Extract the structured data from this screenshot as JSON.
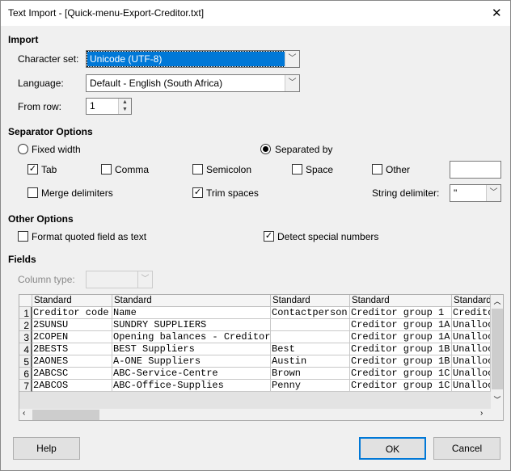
{
  "window": {
    "title": "Text Import - [Quick-menu-Export-Creditor.txt]",
    "close": "✕"
  },
  "import": {
    "heading": "Import",
    "charset_label": "Character set:",
    "charset_value": "Unicode (UTF-8)",
    "language_label": "Language:",
    "language_value": "Default - English (South Africa)",
    "from_row_label": "From row:",
    "from_row_value": "1"
  },
  "separator": {
    "heading": "Separator Options",
    "fixed_width": "Fixed width",
    "separated_by": "Separated by",
    "mode": "separated_by",
    "tab": {
      "label": "Tab",
      "checked": true
    },
    "comma": {
      "label": "Comma",
      "checked": false
    },
    "semicolon": {
      "label": "Semicolon",
      "checked": false
    },
    "space": {
      "label": "Space",
      "checked": false
    },
    "other": {
      "label": "Other",
      "checked": false,
      "value": ""
    },
    "merge": {
      "label": "Merge delimiters",
      "checked": false
    },
    "trim": {
      "label": "Trim spaces",
      "checked": true
    },
    "string_delim_label": "String delimiter:",
    "string_delim_value": "\""
  },
  "other_options": {
    "heading": "Other Options",
    "format_quoted": {
      "label": "Format quoted field as text",
      "checked": false
    },
    "detect_special": {
      "label": "Detect special numbers",
      "checked": true
    }
  },
  "fields": {
    "heading": "Fields",
    "column_type_label": "Column type:",
    "column_type_value": "",
    "headers": [
      "Standard",
      "Standard",
      "Standard",
      "Standard",
      "Standard"
    ],
    "rows": [
      [
        "1",
        "Creditor code",
        "Name",
        "Contactperson",
        "Creditor group 1",
        "Creditor"
      ],
      [
        "2",
        "2SUNSU",
        "SUNDRY SUPPLIERS",
        "",
        "Creditor group 1A",
        "Unallocated"
      ],
      [
        "3",
        "2COPEN",
        "Opening balances - Creditor",
        "",
        "Creditor group 1A",
        "Unallocated"
      ],
      [
        "4",
        "2BESTS",
        "BEST Suppliers",
        "Best",
        "Creditor group 1B",
        "Unallocated"
      ],
      [
        "5",
        "2AONES",
        "A-ONE Suppliers",
        "Austin",
        "Creditor group 1B",
        "Unallocated"
      ],
      [
        "6",
        "2ABCSC",
        "ABC-Service-Centre",
        "Brown",
        "Creditor group 1C",
        "Unallocated"
      ],
      [
        "7",
        "2ABCOS",
        "ABC-Office-Supplies",
        "Penny",
        "Creditor group 1C",
        "Unallocated"
      ]
    ]
  },
  "buttons": {
    "help": "Help",
    "ok": "OK",
    "cancel": "Cancel"
  }
}
